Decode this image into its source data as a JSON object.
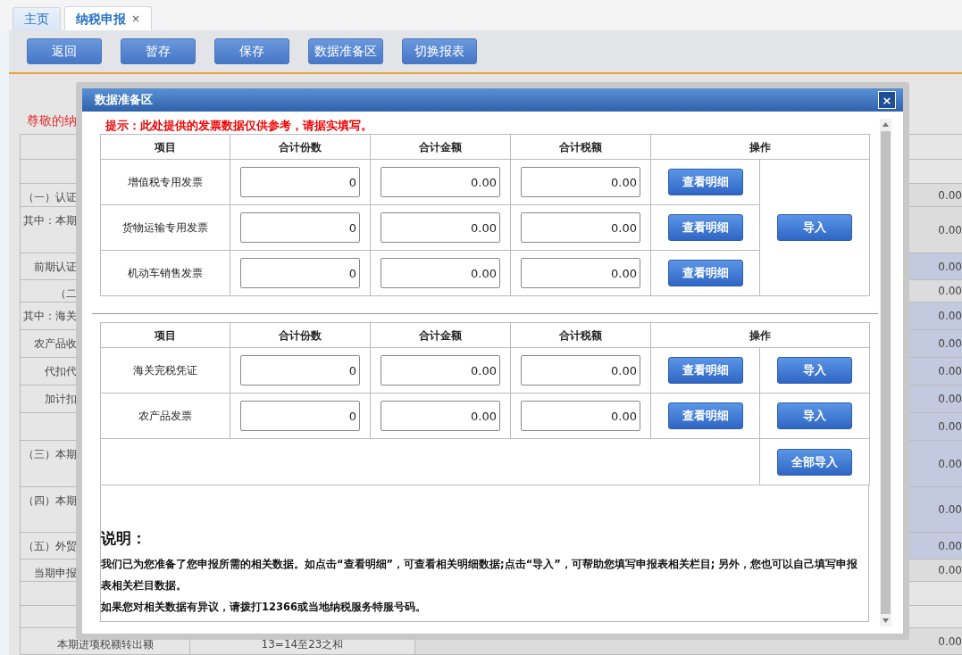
{
  "tabs": [
    {
      "label": "主页",
      "selected": false
    },
    {
      "label": "纳税申报",
      "selected": true,
      "close": "×"
    }
  ],
  "toolbar": [
    "返回",
    "暂存",
    "保存",
    "数据准备区",
    "切换报表"
  ],
  "background": {
    "notice": "尊敬的纳",
    "rows": [
      {},
      {},
      {
        "label": "（一）认证",
        "value": "0.00",
        "highlighted": false
      },
      {
        "label": "其中：本期",
        "value": "0.00",
        "highlighted": false
      },
      {
        "label": "前期认证",
        "value": "0.00",
        "highlighted": true
      },
      {
        "label": "（二",
        "value": "0.00",
        "highlighted": false
      },
      {
        "label": "其中：海关",
        "value": "0.00",
        "highlighted": true
      },
      {
        "label": "农产品收",
        "value": "0.00",
        "highlighted": true
      },
      {
        "label": "代扣代",
        "value": "0.00",
        "highlighted": true
      },
      {
        "label": "加计扣",
        "value": "0.00",
        "highlighted": true
      },
      {
        "value": "0.00",
        "highlighted": true
      },
      {
        "label": "（三）本期",
        "value": "0.00",
        "highlighted": true
      },
      {
        "label": "（四）本期",
        "value": "0.00",
        "highlighted": true
      },
      {
        "label": "（五）外贸",
        "value": "0.00",
        "highlighted": true
      },
      {
        "label": "当期申报",
        "value": "0.00",
        "highlighted": false
      },
      {},
      {},
      {
        "label": "本期进项税额转出额",
        "formula": "13=14至23之和",
        "value": "0.00",
        "highlighted": false
      }
    ]
  },
  "dialog": {
    "title": "数据准备区",
    "close": "×",
    "hint": "提示：此处提供的发票数据仅供参考，请据实填写。",
    "invoice_table": {
      "columns": [
        "项目",
        "合计份数",
        "合计金额",
        "合计税额",
        "操作"
      ],
      "import_button": "导入",
      "rows": [
        {
          "item": "增值税专用发票",
          "count": "0",
          "amount": "0.00",
          "tax": "0.00",
          "detail_button": "查看明细"
        },
        {
          "item": "货物运输专用发票",
          "count": "0",
          "amount": "0.00",
          "tax": "0.00",
          "detail_button": "查看明细"
        },
        {
          "item": "机动车销售发票",
          "count": "0",
          "amount": "0.00",
          "tax": "0.00",
          "detail_button": "查看明细"
        }
      ]
    },
    "customs_table": {
      "columns": [
        "项目",
        "合计份数",
        "合计金额",
        "合计税额",
        "操作"
      ],
      "import_all_button": "全部导入",
      "rows": [
        {
          "item": "海关完税凭证",
          "count": "0",
          "amount": "0.00",
          "tax": "0.00",
          "detail_button": "查看明细",
          "import_button": "导入"
        },
        {
          "item": "农产品发票",
          "count": "0",
          "amount": "0.00",
          "tax": "0.00",
          "detail_button": "查看明细",
          "import_button": "导入"
        }
      ]
    },
    "notes": {
      "heading": "说明：",
      "paragraphs": [
        "我们已为您准备了您申报所需的相关数据。如点击“查看明细”，可查看相关明细数据;点击“导入”，可帮助您填写申报表相关栏目; 另外，您也可以自己填写申报表相关栏目数据。",
        "如果您对相关数据有异议，请拨打12366或当地纳税服务特服号码。"
      ]
    }
  }
}
